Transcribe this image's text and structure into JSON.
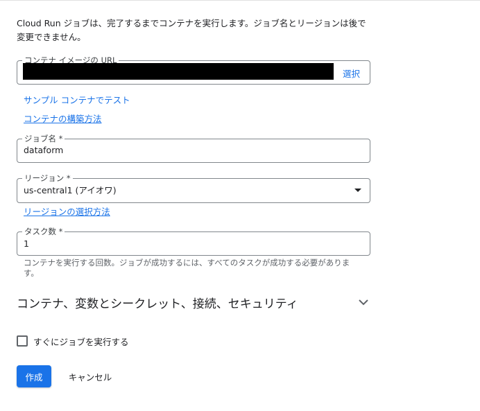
{
  "intro_text": "Cloud Run ジョブは、完了するまでコンテナを実行します。ジョブ名とリージョンは後で変更できません。",
  "image_url": {
    "label": "コンテナ イメージの URL",
    "select_label": "選択"
  },
  "links": {
    "sample_container": "サンプル コンテナでテスト",
    "build_container": "コンテナの構築方法",
    "region_choice": "リージョンの選択方法"
  },
  "job_name": {
    "label": "ジョブ名 *",
    "value": "dataform"
  },
  "region": {
    "label": "リージョン *",
    "value": "us-central1 (アイオワ)"
  },
  "task_count": {
    "label": "タスク数 *",
    "value": "1",
    "hint": "コンテナを実行する回数。ジョブが成功するには、すべてのタスクが成功する必要があります。"
  },
  "advanced_section": {
    "title": "コンテナ、変数とシークレット、接続、セキュリティ",
    "icon": "chevron-down-icon"
  },
  "execute_now": {
    "label": "すぐにジョブを実行する",
    "checked": false
  },
  "buttons": {
    "create": "作成",
    "cancel": "キャンセル"
  },
  "colors": {
    "accent": "#1a73e8",
    "border": "#80868b",
    "hint": "#5f6368"
  }
}
